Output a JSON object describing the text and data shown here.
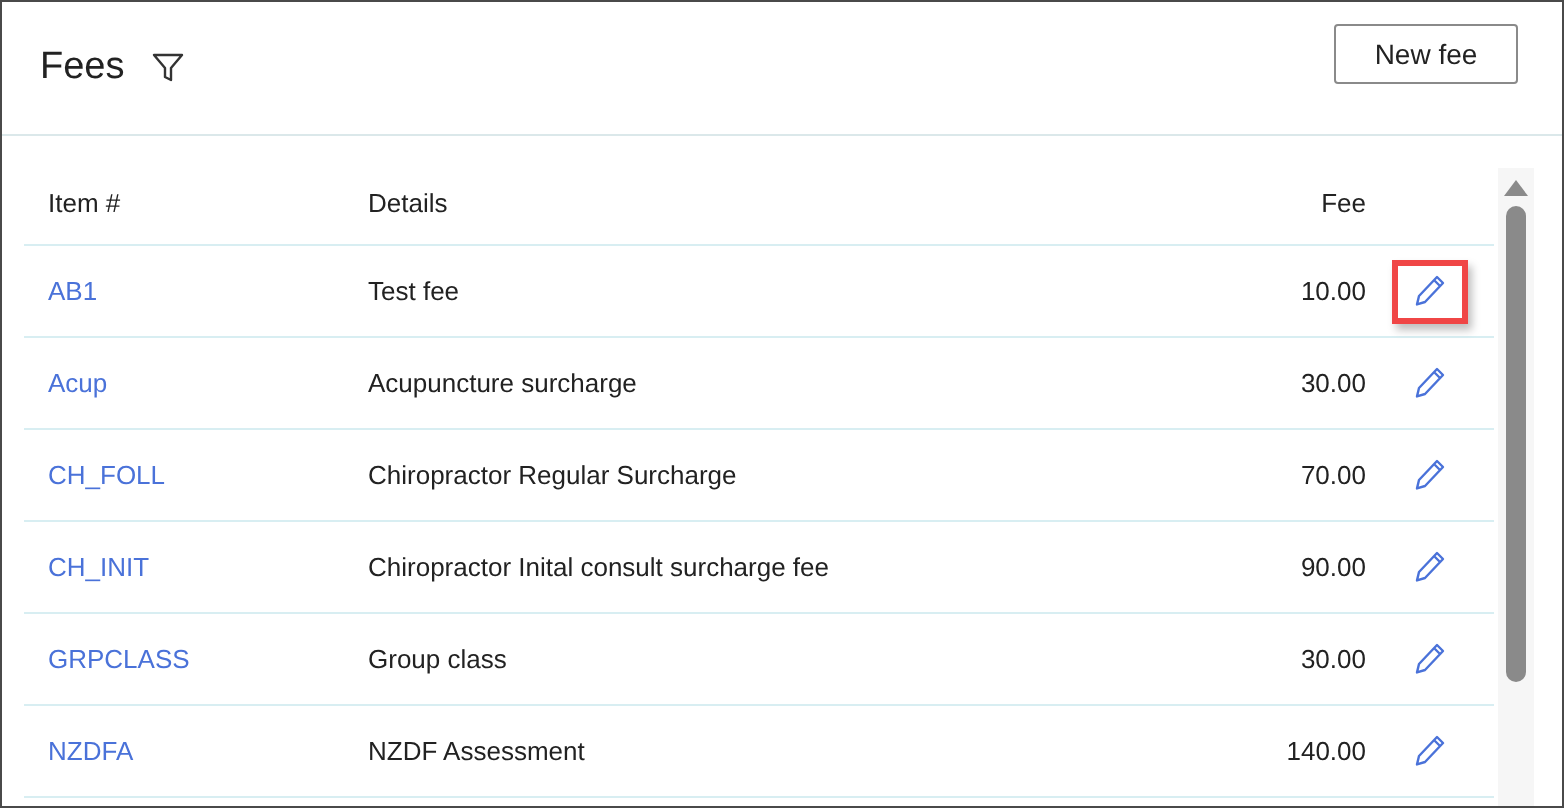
{
  "header": {
    "title": "Fees",
    "new_button": "New fee"
  },
  "table": {
    "columns": [
      "Item #",
      "Details",
      "Fee"
    ],
    "rows": [
      {
        "item": "AB1",
        "details": "Test fee",
        "fee": "10.00",
        "highlighted": true
      },
      {
        "item": "Acup",
        "details": "Acupuncture surcharge",
        "fee": "30.00",
        "highlighted": false
      },
      {
        "item": "CH_FOLL",
        "details": "Chiropractor Regular Surcharge",
        "fee": "70.00",
        "highlighted": false
      },
      {
        "item": "CH_INIT",
        "details": "Chiropractor Inital consult surcharge fee",
        "fee": "90.00",
        "highlighted": false
      },
      {
        "item": "GRPCLASS",
        "details": "Group class",
        "fee": "30.00",
        "highlighted": false
      },
      {
        "item": "NZDFA",
        "details": "NZDF Assessment",
        "fee": "140.00",
        "highlighted": false
      }
    ]
  }
}
